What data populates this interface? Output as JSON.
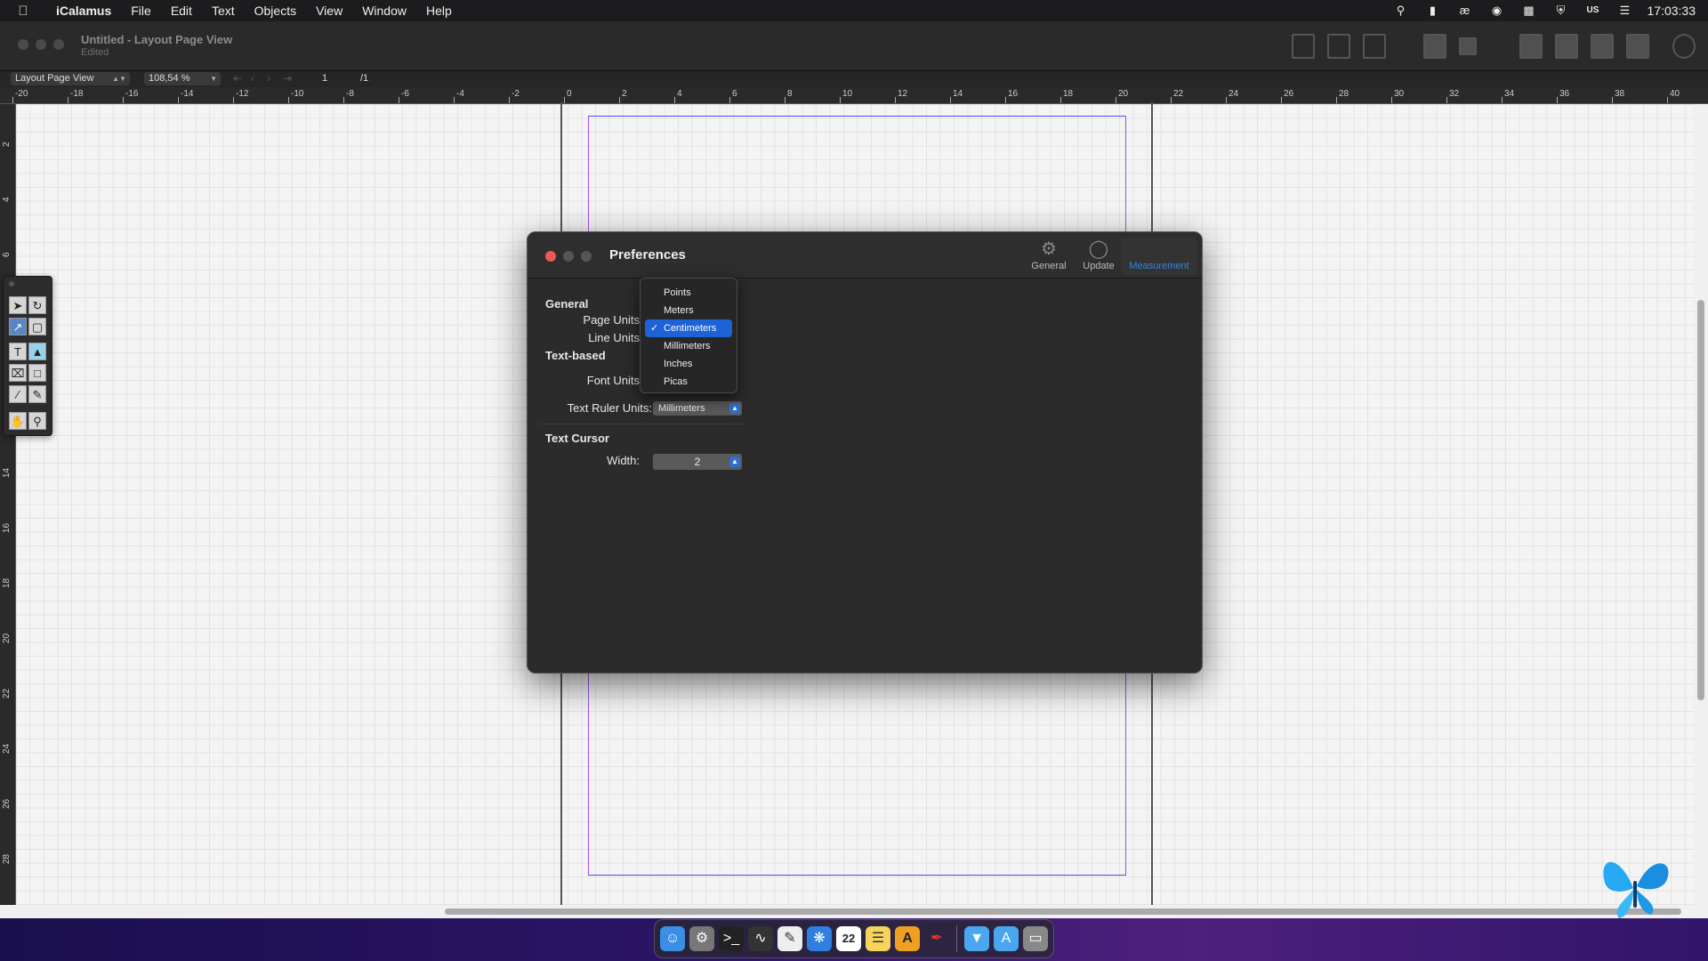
{
  "menubar": {
    "app_name": "iCalamus",
    "items": [
      "File",
      "Edit",
      "Text",
      "Objects",
      "View",
      "Window",
      "Help"
    ],
    "clock": "17:03:33",
    "input_source": "US"
  },
  "window": {
    "title": "Untitled - Layout Page View",
    "subtitle": "Edited"
  },
  "viewbar": {
    "view_mode": "Layout Page View",
    "zoom": "108,54 %",
    "page_current": "1",
    "page_total": "/1"
  },
  "rulers": {
    "horizontal": [
      "-20",
      "-18",
      "-16",
      "-14",
      "-12",
      "-10",
      "-8",
      "-6",
      "-4",
      "-2",
      "0",
      "2",
      "4",
      "6",
      "8",
      "10",
      "12",
      "14",
      "16",
      "18",
      "20",
      "22",
      "24",
      "26",
      "28",
      "30",
      "32",
      "34",
      "36",
      "38",
      "40"
    ],
    "vertical": [
      "2",
      "4",
      "6",
      "8",
      "10",
      "12",
      "14",
      "16",
      "18",
      "20",
      "22",
      "24",
      "26",
      "28"
    ]
  },
  "preferences": {
    "title": "Preferences",
    "tabs": [
      {
        "label": "General",
        "icon": "gear-icon"
      },
      {
        "label": "Update",
        "icon": "globe-icon"
      },
      {
        "label": "Measurement",
        "icon": "ruler-icon"
      }
    ],
    "active_tab": "Measurement",
    "sections": {
      "general": "General",
      "text_based": "Text-based",
      "text_cursor": "Text Cursor"
    },
    "fields": {
      "page_units_label": "Page Units",
      "line_units_label": "Line Units",
      "font_units_label": "Font Units",
      "text_ruler_label": "Text Ruler Units:",
      "text_ruler_value": "Millimeters",
      "width_label": "Width:",
      "width_value": "2"
    },
    "dropdown": {
      "options": [
        "Points",
        "Meters",
        "Centimeters",
        "Millimeters",
        "Inches",
        "Picas"
      ],
      "selected": "Centimeters"
    }
  },
  "dock": {
    "apps": [
      "finder-icon",
      "launchpad-icon",
      "terminal-icon",
      "activity-monitor-icon",
      "textedit-icon",
      "safari-icon",
      "calendar-icon",
      "notes-icon",
      "icalamus-icon",
      "feather-icon",
      "downloads-icon",
      "applications-icon",
      "trash-icon"
    ],
    "calendar_day": "22"
  },
  "colors": {
    "accent": "#1d62d6",
    "close_red": "#ee5a52",
    "margin_magenta": "#a24ef0"
  }
}
